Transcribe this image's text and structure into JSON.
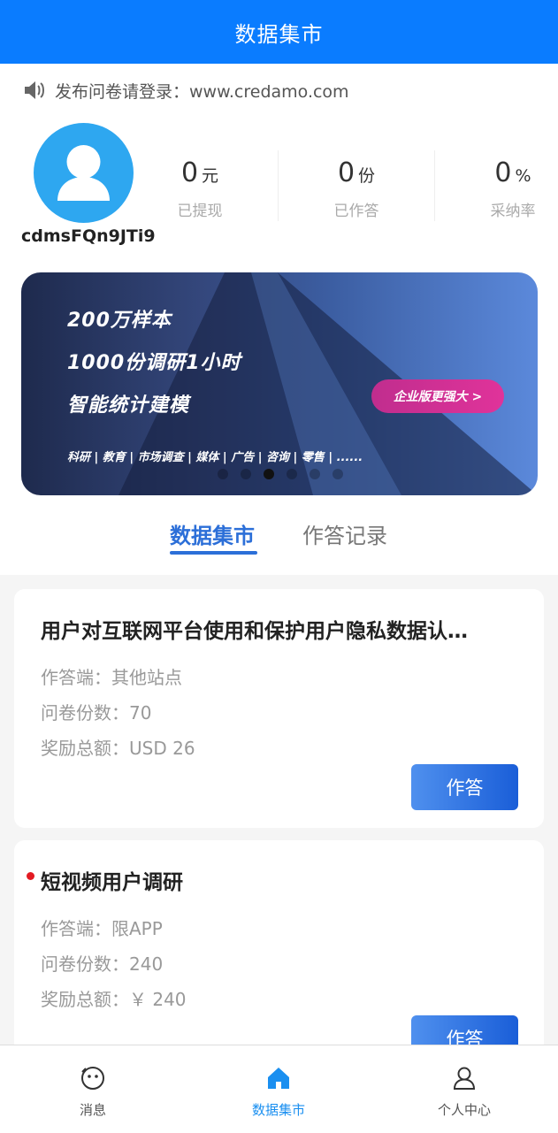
{
  "header": {
    "title": "数据集市"
  },
  "notice": {
    "text": "发布问卷请登录：www.credamo.com"
  },
  "profile": {
    "username": "cdmsFQn9JTi9",
    "stats": [
      {
        "value": "0",
        "unit": "元",
        "label": "已提现"
      },
      {
        "value": "0",
        "unit": "份",
        "label": "已作答"
      },
      {
        "value": "0",
        "unit": "%",
        "label": "采纳率"
      }
    ]
  },
  "banner": {
    "line1": "200万样本",
    "line2": "1000份调研1小时",
    "line3": "智能统计建模",
    "cta": "企业版更强大 >",
    "tags": "科研 | 教育 | 市场调查 | 媒体 | 广告 | 咨询 | 零售 | ......",
    "carousel": {
      "count": 6,
      "active_index": 2
    }
  },
  "tabs": [
    {
      "label": "数据集市",
      "active": true
    },
    {
      "label": "作答记录",
      "active": false
    }
  ],
  "surveys": [
    {
      "title": "用户对互联网平台使用和保护用户隐私数据认…",
      "platform": "作答端：其他站点",
      "count": "问卷份数：70",
      "reward": "奖励总额：USD 26",
      "button": "作答",
      "is_new": false
    },
    {
      "title": "短视频用户调研",
      "platform": "作答端：限APP",
      "count": "问卷份数：240",
      "reward": "奖励总额：￥ 240",
      "button": "作答",
      "is_new": true
    }
  ],
  "bottom_nav": [
    {
      "label": "消息",
      "icon": "message-face-icon",
      "active": false
    },
    {
      "label": "数据集市",
      "icon": "home-icon",
      "active": true
    },
    {
      "label": "个人中心",
      "icon": "person-icon",
      "active": false
    }
  ],
  "colors": {
    "primary": "#0a7cff",
    "tab_active": "#2c6fd8",
    "nav_active": "#1a8ff0",
    "new_dot": "#e31b23"
  }
}
